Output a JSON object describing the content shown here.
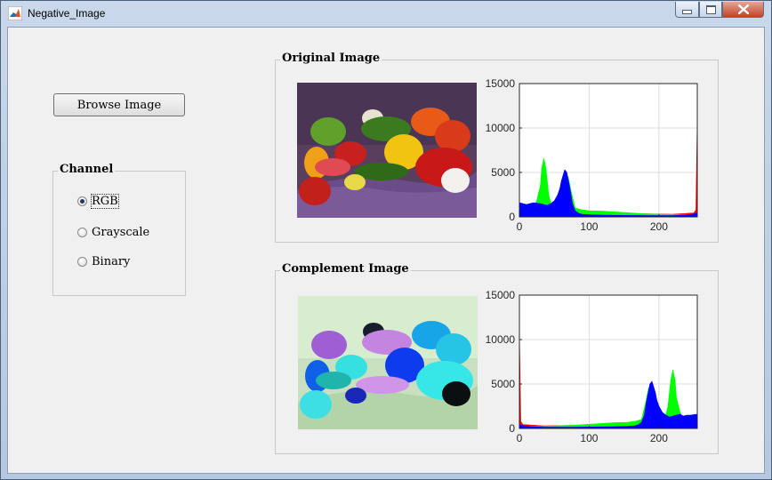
{
  "window": {
    "title": "Negative_Image"
  },
  "controls": {
    "browse_label": "Browse Image"
  },
  "channel": {
    "title": "Channel",
    "options": [
      {
        "label": "RGB",
        "selected": true
      },
      {
        "label": "Grayscale",
        "selected": false
      },
      {
        "label": "Binary",
        "selected": false
      }
    ]
  },
  "original": {
    "title": "Original Image"
  },
  "complement": {
    "title": "Complement Image"
  },
  "colors": {
    "red": "#ff0000",
    "green": "#00ff00",
    "blue": "#0000ff"
  },
  "chart_data": [
    {
      "type": "area",
      "ylim": [
        0,
        15000
      ],
      "xlim": [
        0,
        255
      ],
      "xticks": [
        0,
        100,
        200
      ],
      "yticks": [
        0,
        5000,
        10000,
        15000
      ],
      "grid": true,
      "series": [
        {
          "color": "red",
          "x": [
            0,
            10,
            20,
            30,
            40,
            50,
            60,
            70,
            80,
            90,
            100,
            120,
            140,
            160,
            180,
            200,
            220,
            240,
            250,
            253,
            254,
            255
          ],
          "y": [
            1000,
            900,
            700,
            550,
            450,
            400,
            350,
            300,
            350,
            420,
            500,
            450,
            420,
            380,
            350,
            320,
            300,
            400,
            450,
            800,
            6000,
            11000
          ]
        },
        {
          "color": "green",
          "x": [
            0,
            10,
            20,
            25,
            30,
            32,
            35,
            38,
            42,
            46,
            50,
            55,
            60,
            65,
            70,
            75,
            80,
            90,
            100,
            120,
            140,
            160,
            180,
            200,
            220,
            240,
            255
          ],
          "y": [
            300,
            600,
            1000,
            1900,
            3500,
            5500,
            6600,
            5500,
            2500,
            1300,
            1200,
            1400,
            2000,
            3800,
            4500,
            2600,
            1000,
            800,
            700,
            650,
            550,
            450,
            350,
            300,
            250,
            200,
            150
          ]
        },
        {
          "color": "blue",
          "x": [
            0,
            5,
            10,
            20,
            30,
            35,
            40,
            45,
            50,
            55,
            58,
            60,
            63,
            65,
            68,
            70,
            73,
            76,
            80,
            85,
            90,
            100,
            120,
            140,
            160,
            180,
            200,
            220,
            240,
            255
          ],
          "y": [
            1600,
            1500,
            1400,
            1600,
            1500,
            1400,
            1300,
            1500,
            1800,
            2500,
            3200,
            4000,
            4800,
            5300,
            5000,
            4200,
            3000,
            1500,
            700,
            400,
            300,
            250,
            200,
            180,
            160,
            150,
            150,
            150,
            200,
            400
          ]
        }
      ]
    },
    {
      "type": "area",
      "ylim": [
        0,
        15000
      ],
      "xlim": [
        0,
        255
      ],
      "xticks": [
        0,
        100,
        200
      ],
      "yticks": [
        0,
        5000,
        10000,
        15000
      ],
      "grid": true,
      "series": [
        {
          "color": "red",
          "x": [
            0,
            1,
            2,
            5,
            15,
            35,
            55,
            75,
            95,
            115,
            135,
            155,
            175,
            185,
            195,
            205,
            215,
            225,
            235,
            245,
            255
          ],
          "y": [
            11000,
            6000,
            800,
            450,
            400,
            300,
            320,
            350,
            380,
            420,
            450,
            500,
            420,
            350,
            300,
            350,
            400,
            450,
            550,
            700,
            900
          ]
        },
        {
          "color": "green",
          "x": [
            0,
            15,
            35,
            55,
            75,
            95,
            115,
            135,
            155,
            165,
            175,
            180,
            185,
            190,
            195,
            200,
            205,
            209,
            213,
            217,
            220,
            223,
            225,
            230,
            235,
            245,
            255
          ],
          "y": [
            150,
            200,
            250,
            300,
            350,
            450,
            550,
            650,
            700,
            800,
            1000,
            2600,
            4500,
            3800,
            2000,
            1400,
            1200,
            1300,
            2500,
            5500,
            6600,
            5500,
            3500,
            1900,
            1000,
            600,
            300
          ]
        },
        {
          "color": "blue",
          "x": [
            0,
            15,
            35,
            55,
            75,
            95,
            115,
            135,
            155,
            165,
            170,
            175,
            179,
            182,
            185,
            187,
            190,
            192,
            195,
            197,
            200,
            205,
            210,
            215,
            220,
            225,
            230,
            235,
            240,
            245,
            255
          ],
          "y": [
            400,
            200,
            150,
            150,
            150,
            160,
            180,
            200,
            250,
            300,
            400,
            700,
            1500,
            3000,
            4200,
            5000,
            5300,
            4800,
            4000,
            3200,
            2500,
            1800,
            1500,
            1300,
            1400,
            1500,
            1600,
            1400,
            1500,
            1500,
            1600
          ]
        }
      ]
    }
  ]
}
